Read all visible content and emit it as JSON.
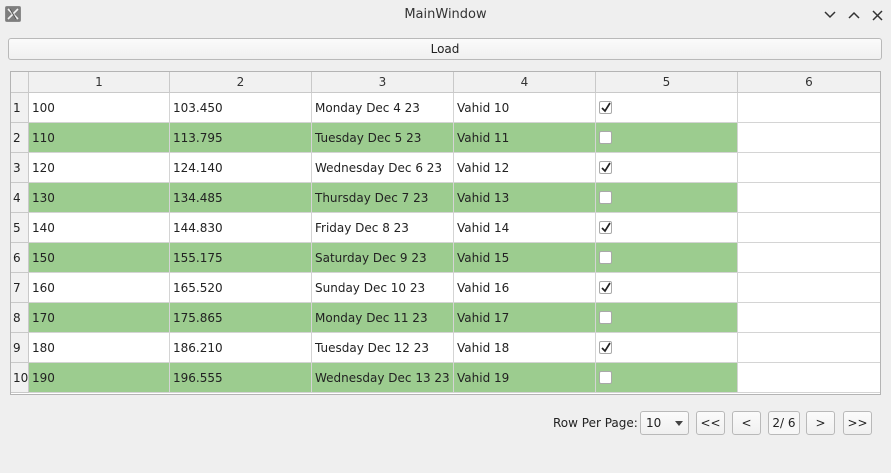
{
  "window": {
    "title": "MainWindow",
    "controls": [
      "chevron-down-icon",
      "chevron-up-icon",
      "close-icon"
    ]
  },
  "toolbar": {
    "load_label": "Load"
  },
  "table": {
    "columns": [
      "1",
      "2",
      "3",
      "4",
      "5",
      "6"
    ],
    "rows": [
      {
        "num": "1",
        "c1": "100",
        "c2": "103.450",
        "c3": "Monday Dec 4 23",
        "c4": "Vahid 10",
        "checked": true,
        "highlight": false
      },
      {
        "num": "2",
        "c1": "110",
        "c2": "113.795",
        "c3": "Tuesday Dec 5 23",
        "c4": "Vahid 11",
        "checked": false,
        "highlight": true
      },
      {
        "num": "3",
        "c1": "120",
        "c2": "124.140",
        "c3": "Wednesday Dec 6 23",
        "c4": "Vahid 12",
        "checked": true,
        "highlight": false
      },
      {
        "num": "4",
        "c1": "130",
        "c2": "134.485",
        "c3": "Thursday Dec 7 23",
        "c4": "Vahid 13",
        "checked": false,
        "highlight": true
      },
      {
        "num": "5",
        "c1": "140",
        "c2": "144.830",
        "c3": "Friday Dec 8 23",
        "c4": "Vahid 14",
        "checked": true,
        "highlight": false
      },
      {
        "num": "6",
        "c1": "150",
        "c2": "155.175",
        "c3": "Saturday Dec 9 23",
        "c4": "Vahid 15",
        "checked": false,
        "highlight": true
      },
      {
        "num": "7",
        "c1": "160",
        "c2": "165.520",
        "c3": "Sunday Dec 10 23",
        "c4": "Vahid 16",
        "checked": true,
        "highlight": false
      },
      {
        "num": "8",
        "c1": "170",
        "c2": "175.865",
        "c3": "Monday Dec 11 23",
        "c4": "Vahid 17",
        "checked": false,
        "highlight": true
      },
      {
        "num": "9",
        "c1": "180",
        "c2": "186.210",
        "c3": "Tuesday Dec 12 23",
        "c4": "Vahid 18",
        "checked": true,
        "highlight": false
      },
      {
        "num": "10",
        "c1": "190",
        "c2": "196.555",
        "c3": "Wednesday Dec 13 23",
        "c4": "Vahid 19",
        "checked": false,
        "highlight": true
      }
    ]
  },
  "pagination": {
    "label": "Row Per Page:",
    "rows_per_page": "10",
    "first_label": "<<",
    "prev_label": "<",
    "page_indicator": "2/ 6",
    "next_label": ">",
    "last_label": ">>"
  },
  "colors": {
    "highlight_row": "#9ccc8f",
    "background": "#efefef"
  }
}
